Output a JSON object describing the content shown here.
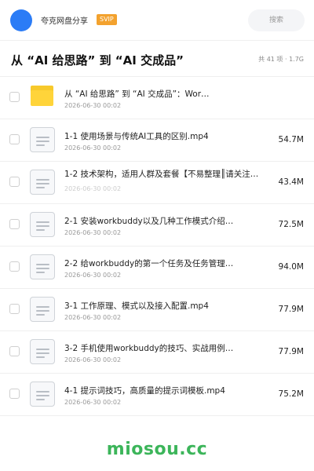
{
  "header": {
    "user_name": "夸克网盘分享",
    "badge": "SVIP",
    "search_placeholder": "搜索"
  },
  "folder": {
    "title": "从 “AI 给思路” 到 “AI 交成品”",
    "summary": "共 41 项 · 1.7G"
  },
  "files": [
    {
      "type": "folder",
      "name": "从 “AI 给思路” 到 “AI 交成品”：Wor…",
      "date": "2026-06-30 00:02",
      "size": ""
    },
    {
      "type": "file",
      "name": "1-1 使用场景与传统AI工具的区别.mp4",
      "date": "2026-06-30 00:02",
      "size": "54.7M"
    },
    {
      "type": "file",
      "name": "1-2 技术架构，适用人群及套餐【不易整理║请关注…",
      "date": "2026-06-30 00:02",
      "size": "43.4M"
    },
    {
      "type": "file",
      "name": "2-1 安装workbuddy以及几种工作模式介绍…",
      "date": "2026-06-30 00:02",
      "size": "72.5M"
    },
    {
      "type": "file",
      "name": "2-2 给workbuddy的第一个任务及任务管理…",
      "date": "2026-06-30 00:02",
      "size": "94.0M"
    },
    {
      "type": "file",
      "name": "3-1 工作原理、模式以及接入配置.mp4",
      "date": "2026-06-30 00:02",
      "size": "77.9M"
    },
    {
      "type": "file",
      "name": "3-2 手机使用workbuddy的技巧、实战用例…",
      "date": "2026-06-30 00:02",
      "size": "77.9M"
    },
    {
      "type": "file",
      "name": "4-1 提示词技巧，高质量的提示词模板.mp4",
      "date": "2026-06-30 00:02",
      "size": "75.2M"
    }
  ],
  "watermark": "miosou.cc",
  "colors": {
    "avatar": "#2b7cf6",
    "svip_badge": "#f3a22e",
    "folder": "#ffd43a",
    "watermark": "#3cb55a"
  }
}
